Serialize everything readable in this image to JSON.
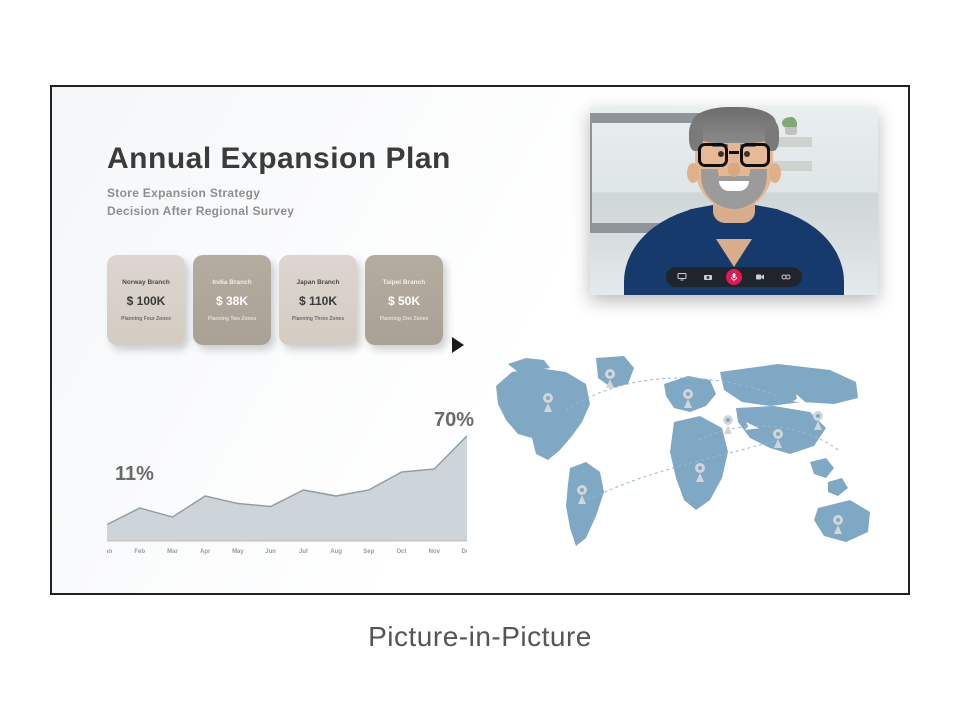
{
  "caption": "Picture-in-Picture",
  "slide": {
    "title": "Annual Expansion Plan",
    "subtitle_line1": "Store Expansion Strategy",
    "subtitle_line2": "Decision After Regional Survey"
  },
  "cards": [
    {
      "name": "Norway Branch",
      "amount": "$ 100K",
      "zones": "Planning Four Zones"
    },
    {
      "name": "India Branch",
      "amount": "$ 38K",
      "zones": "Planning Two Zones"
    },
    {
      "name": "Japan Branch",
      "amount": "$ 110K",
      "zones": "Planning Three Zones"
    },
    {
      "name": "Taipei Branch",
      "amount": "$ 50K",
      "zones": "Planning One Zones"
    }
  ],
  "chart_labels": {
    "start": "11%",
    "end": "70%"
  },
  "chart_data": {
    "type": "area",
    "title": "",
    "xlabel": "",
    "ylabel": "",
    "ylim": [
      0,
      100
    ],
    "categories": [
      "Jan",
      "Feb",
      "Mar",
      "Apr",
      "May",
      "Jun",
      "Jul",
      "Aug",
      "Sep",
      "Oct",
      "Nov",
      "Dec"
    ],
    "values": [
      11,
      22,
      16,
      30,
      25,
      23,
      34,
      30,
      34,
      46,
      48,
      70
    ],
    "annotations": [
      {
        "x": "Jan",
        "label": "11%"
      },
      {
        "x": "Dec",
        "label": "70%"
      }
    ]
  },
  "pip": {
    "toolbar_icons": [
      "monitor-icon",
      "camera-icon",
      "mic-icon",
      "video-icon",
      "link-icon"
    ]
  }
}
